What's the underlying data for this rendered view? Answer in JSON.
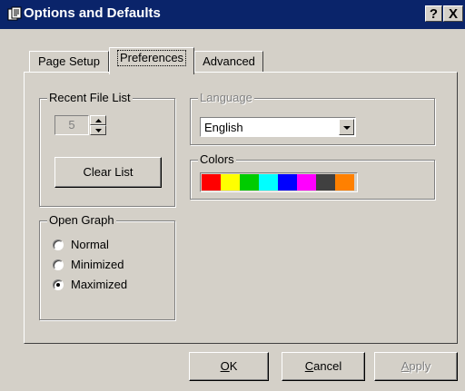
{
  "window": {
    "title": "Options and Defaults",
    "help_label": "?",
    "close_label": "X"
  },
  "tabs": [
    {
      "label": "Page Setup",
      "active": false
    },
    {
      "label": "Preferences",
      "active": true
    },
    {
      "label": "Advanced",
      "active": false
    }
  ],
  "recent_files": {
    "label": "Recent File List",
    "count": "5",
    "clear_button": "Clear List"
  },
  "open_graph": {
    "label": "Open Graph",
    "options": [
      {
        "label": "Normal",
        "selected": false
      },
      {
        "label": "Minimized",
        "selected": false
      },
      {
        "label": "Maximized",
        "selected": true
      }
    ]
  },
  "language": {
    "label": "Language",
    "value": "English",
    "enabled": false
  },
  "colors": {
    "label": "Colors",
    "swatches": [
      "#ff0000",
      "#ffff00",
      "#00cc00",
      "#00ffff",
      "#0000ff",
      "#ff00ff",
      "#404040",
      "#ff8000"
    ]
  },
  "footer": {
    "ok": {
      "accel": "O",
      "rest": "K"
    },
    "cancel": {
      "accel": "C",
      "rest": "ancel"
    },
    "apply": {
      "accel": "A",
      "rest": "pply"
    }
  }
}
